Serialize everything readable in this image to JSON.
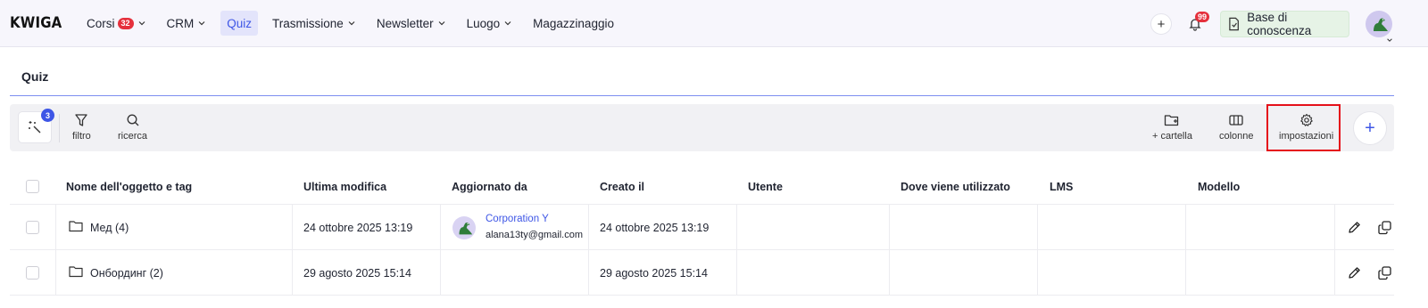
{
  "app": {
    "logo": "KWIGA"
  },
  "nav": {
    "items": [
      {
        "label": "Corsi",
        "badge": "32",
        "has_caret": true
      },
      {
        "label": "CRM",
        "has_caret": true
      },
      {
        "label": "Quiz",
        "active": true
      },
      {
        "label": "Trasmissione",
        "has_caret": true
      },
      {
        "label": "Newsletter",
        "has_caret": true
      },
      {
        "label": "Luogo",
        "has_caret": true
      },
      {
        "label": "Magazzinaggio"
      }
    ]
  },
  "header_right": {
    "add_icon": "plus-icon",
    "notifications_badge": "99",
    "knowledge_base_label": "Base di conoscenza"
  },
  "page": {
    "title": "Quiz"
  },
  "toolbar": {
    "magic_badge": "3",
    "filter_label": "filtro",
    "search_label": "ricerca",
    "folder_label": "+ cartella",
    "columns_label": "colonne",
    "settings_label": "impostazioni",
    "add_icon": "+"
  },
  "table": {
    "headers": [
      "Nome dell'oggetto e tag",
      "Ultima modifica",
      "Aggiornato da",
      "Creato il",
      "Utente",
      "Dove viene utilizzato",
      "LMS",
      "Modello"
    ],
    "rows": [
      {
        "name": "Мед (4)",
        "modified": "24 ottobre 2025 13:19",
        "updated_by_name": "Corporation Y",
        "updated_by_email": "alana13ty@gmail.com",
        "created": "24 ottobre 2025 13:19"
      },
      {
        "name": "Онбординг (2)",
        "modified": "29 agosto 2025 15:14",
        "updated_by_name": "",
        "updated_by_email": "",
        "created": "29 agosto 2025 15:14"
      }
    ]
  },
  "colors": {
    "accent": "#3e56e6",
    "badge": "#e5303c",
    "highlight": "#e5101a"
  }
}
